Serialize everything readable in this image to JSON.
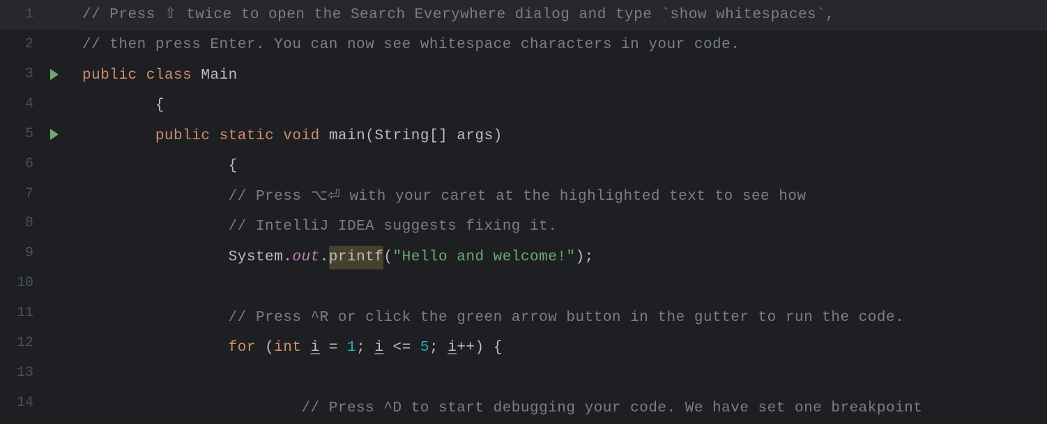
{
  "gutter": {
    "numbers": [
      "1",
      "2",
      "3",
      "4",
      "5",
      "6",
      "7",
      "8",
      "9",
      "10",
      "11",
      "12",
      "13",
      "14"
    ],
    "run_icons_at": [
      3,
      5
    ]
  },
  "code": {
    "l1": {
      "c1": "// Press ⇧ twice to open the Search Everywhere dialog and type `show whitespaces`,"
    },
    "l2": {
      "c1": "// then press Enter. You can now see whitespace characters in your code."
    },
    "l3": {
      "kw1": "public",
      "sp1": " ",
      "kw2": "class",
      "sp2": " ",
      "name": "Main"
    },
    "l4": {
      "indent": "        ",
      "brace": "{"
    },
    "l5": {
      "indent": "        ",
      "kw1": "public",
      "sp1": " ",
      "kw2": "static",
      "sp2": " ",
      "kw3": "void",
      "sp3": " ",
      "method": "main",
      "lparen": "(",
      "type": "String",
      "arr": "[] ",
      "arg": "args",
      "rparen": ")"
    },
    "l6": {
      "indent": "                ",
      "brace": "{"
    },
    "l7": {
      "indent": "                ",
      "c1": "// Press ⌥⏎ with your caret at the highlighted text to see how"
    },
    "l8": {
      "indent": "                ",
      "c1": "// IntelliJ IDEA suggests fixing it."
    },
    "l9": {
      "indent": "                ",
      "obj": "System",
      "dot1": ".",
      "field": "out",
      "dot2": ".",
      "method": "printf",
      "lparen": "(",
      "str": "\"Hello and welcome!\"",
      "rparen": ")",
      "semi": ";"
    },
    "l10": {
      "blank": " "
    },
    "l11": {
      "indent": "                ",
      "c1": "// Press ^R or click the green arrow button in the gutter to run the code."
    },
    "l12": {
      "indent": "                ",
      "kw1": "for",
      "sp1": " ",
      "lparen": "(",
      "type": "int",
      "sp2": " ",
      "var1": "i",
      "sp3": " = ",
      "num1": "1",
      "semi1": "; ",
      "var2": "i",
      "sp4": " <= ",
      "num2": "5",
      "semi2": "; ",
      "var3": "i",
      "inc": "++",
      "rparen": ")",
      "sp5": " ",
      "brace": "{"
    },
    "l13": {
      "blank": " "
    },
    "l14": {
      "indent": "                        ",
      "c1": "// Press ^D to start debugging your code. We have set one breakpoint"
    }
  }
}
